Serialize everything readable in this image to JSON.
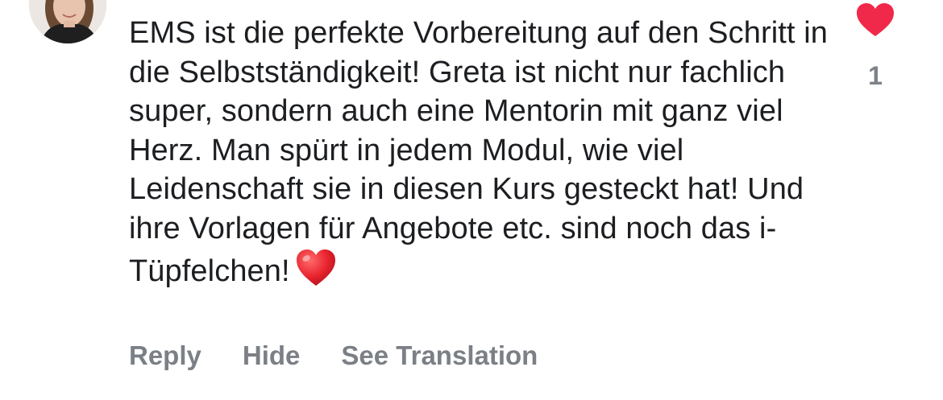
{
  "comment": {
    "text": "EMS ist die perfekte Vorbereitung auf den Schritt in die Selbstständigkeit! Greta ist nicht nur fachlich super, sondern auch eine Mentorin mit ganz viel Herz. Man spürt in jedem Modul, wie viel Leidenschaft sie in diesen Kurs gesteckt hat! Und ihre Vorlagen für Angebote etc. sind noch das i-Tüpfelchen!",
    "emoji": "red-heart-emoji"
  },
  "likes": {
    "icon": "heart-icon",
    "count": "1",
    "color": "#f02849"
  },
  "actions": {
    "reply": "Reply",
    "hide": "Hide",
    "see_translation": "See Translation"
  },
  "colors": {
    "text": "#1c1e21",
    "secondary": "#7b7f86",
    "heart": "#f02849"
  }
}
